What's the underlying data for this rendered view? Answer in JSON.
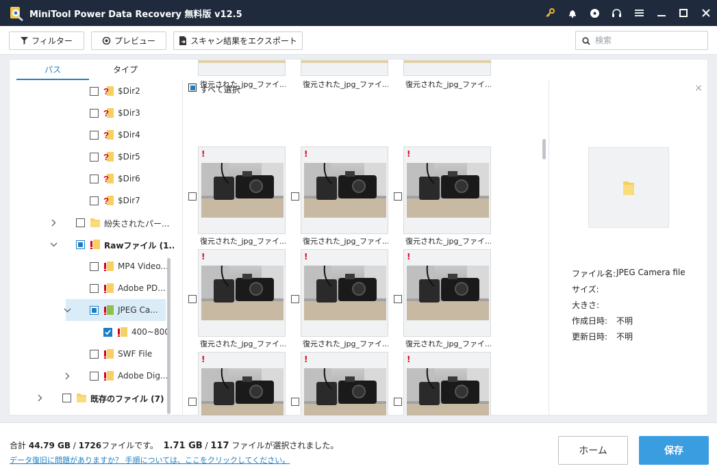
{
  "titlebar": {
    "title": "MiniTool Power Data Recovery 無料版 v12.5",
    "icons": [
      "key-icon",
      "bell-icon",
      "disc-icon",
      "headset-icon",
      "menu-icon",
      "minimize-icon",
      "maximize-icon",
      "close-icon"
    ]
  },
  "toolbar": {
    "filter_label": "フィルター",
    "preview_label": "プレビュー",
    "export_label": "スキャン結果をエクスポート",
    "search_placeholder": "検索"
  },
  "tabs": [
    {
      "label": "パス",
      "active": true
    },
    {
      "label": "タイプ",
      "active": false
    }
  ],
  "tree": [
    {
      "label": "$Dir2",
      "icon": "unknown-folder-icon",
      "checked": "none"
    },
    {
      "label": "$Dir3",
      "icon": "unknown-folder-icon",
      "checked": "none"
    },
    {
      "label": "$Dir4",
      "icon": "unknown-folder-icon",
      "checked": "none"
    },
    {
      "label": "$Dir5",
      "icon": "unknown-folder-icon",
      "checked": "none"
    },
    {
      "label": "$Dir6",
      "icon": "unknown-folder-icon",
      "checked": "none"
    },
    {
      "label": "$Dir7",
      "icon": "unknown-folder-icon",
      "checked": "none"
    },
    {
      "label": "紛失されたパー...",
      "icon": "folder-icon",
      "checked": "none",
      "expander": "collapsed"
    },
    {
      "label": "Rawファイル (1...",
      "icon": "raw-folder-icon",
      "checked": "partial",
      "expander": "expanded",
      "bold": true
    },
    {
      "label": "MP4 Video...",
      "icon": "raw-folder-icon",
      "checked": "none"
    },
    {
      "label": "Adobe PD...",
      "icon": "raw-folder-icon",
      "checked": "none"
    },
    {
      "label": "JPEG Ca...",
      "icon": "raw-folder-icon",
      "checked": "partial",
      "expander": "expanded",
      "selected": true
    },
    {
      "label": "400~800",
      "icon": "raw-folder-icon",
      "checked": "checked"
    },
    {
      "label": "SWF File",
      "icon": "raw-folder-icon",
      "checked": "none"
    },
    {
      "label": "Adobe Dig...",
      "icon": "raw-folder-icon",
      "checked": "none",
      "expander": "collapsed"
    },
    {
      "label": "既存のファイル (7)",
      "icon": "folder-icon",
      "checked": "none",
      "expander": "collapsed",
      "bold": true
    }
  ],
  "grid": {
    "select_all_label": "すべて選択",
    "file_caption": "復元された_jpg_ファイ...",
    "warn_mark": "!"
  },
  "preview": {
    "close_symbol": "×",
    "fields": [
      {
        "label": "ファイル名:",
        "value": "JPEG Camera file"
      },
      {
        "label": "サイズ:",
        "value": ""
      },
      {
        "label": "大きさ:",
        "value": ""
      },
      {
        "label": "作成日時:",
        "value": "不明"
      },
      {
        "label": "更新日時:",
        "value": "不明"
      }
    ]
  },
  "footer": {
    "summary_prefix": "合計",
    "total_size": "44.79 GB",
    "total_files": "1726",
    "files_text": "ファイルです。",
    "selected_size": "1.71 GB",
    "selected_count": "117",
    "selected_text": "ファイルが選択されました。",
    "help_link": "データ復旧に問題がありますか？ 手順については、ここをクリックしてください。",
    "home_label": "ホーム",
    "save_label": "保存"
  },
  "colors": {
    "accent": "#1b7ec4",
    "save_button": "#3a9de0",
    "titlebar": "#1f2b3d",
    "warning": "#e0001b"
  }
}
